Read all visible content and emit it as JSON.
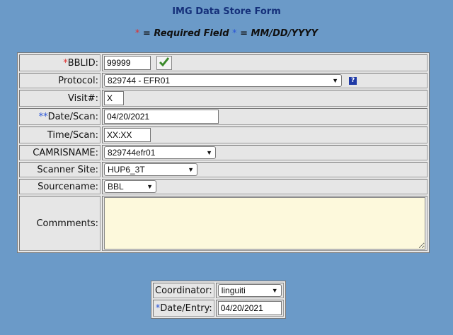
{
  "page": {
    "title": "IMG Data Store Form",
    "legend": {
      "required_star": "*",
      "required_text": " = Required Field ",
      "date_star": "*",
      "date_text": " = MM/DD/YYYY"
    }
  },
  "form": {
    "bblid": {
      "star": "*",
      "label": "BBLID:",
      "value": "99999"
    },
    "protocol": {
      "label": "Protocol:",
      "value": "829744 - EFR01"
    },
    "visit": {
      "label": "Visit#:",
      "value": "X"
    },
    "date_scan": {
      "star": "**",
      "label": "Date/Scan:",
      "value": "04/20/2021"
    },
    "time_scan": {
      "label": "Time/Scan:",
      "value": "XX:XX"
    },
    "camrisname": {
      "label": "CAMRISNAME:",
      "value": "829744efr01"
    },
    "scanner_site": {
      "label": "Scanner Site:",
      "value": "HUP6_3T"
    },
    "sourcename": {
      "label": "Sourcename:",
      "value": "BBL"
    },
    "comments": {
      "label": "Commments:",
      "value": ""
    }
  },
  "footer": {
    "coordinator": {
      "label": "Coordinator:",
      "value": "linguiti"
    },
    "date_entry": {
      "star": "*",
      "label": "Date/Entry:",
      "value": "04/20/2021"
    }
  },
  "icons": {
    "check": "check-icon",
    "help": "help-icon",
    "dropdown": "chevron-down-icon"
  },
  "colors": {
    "background": "#6b9ac8",
    "title": "#15307a",
    "required": "#e03030",
    "date_marker": "#2a55d8",
    "comments_bg": "#fdf9dc"
  }
}
